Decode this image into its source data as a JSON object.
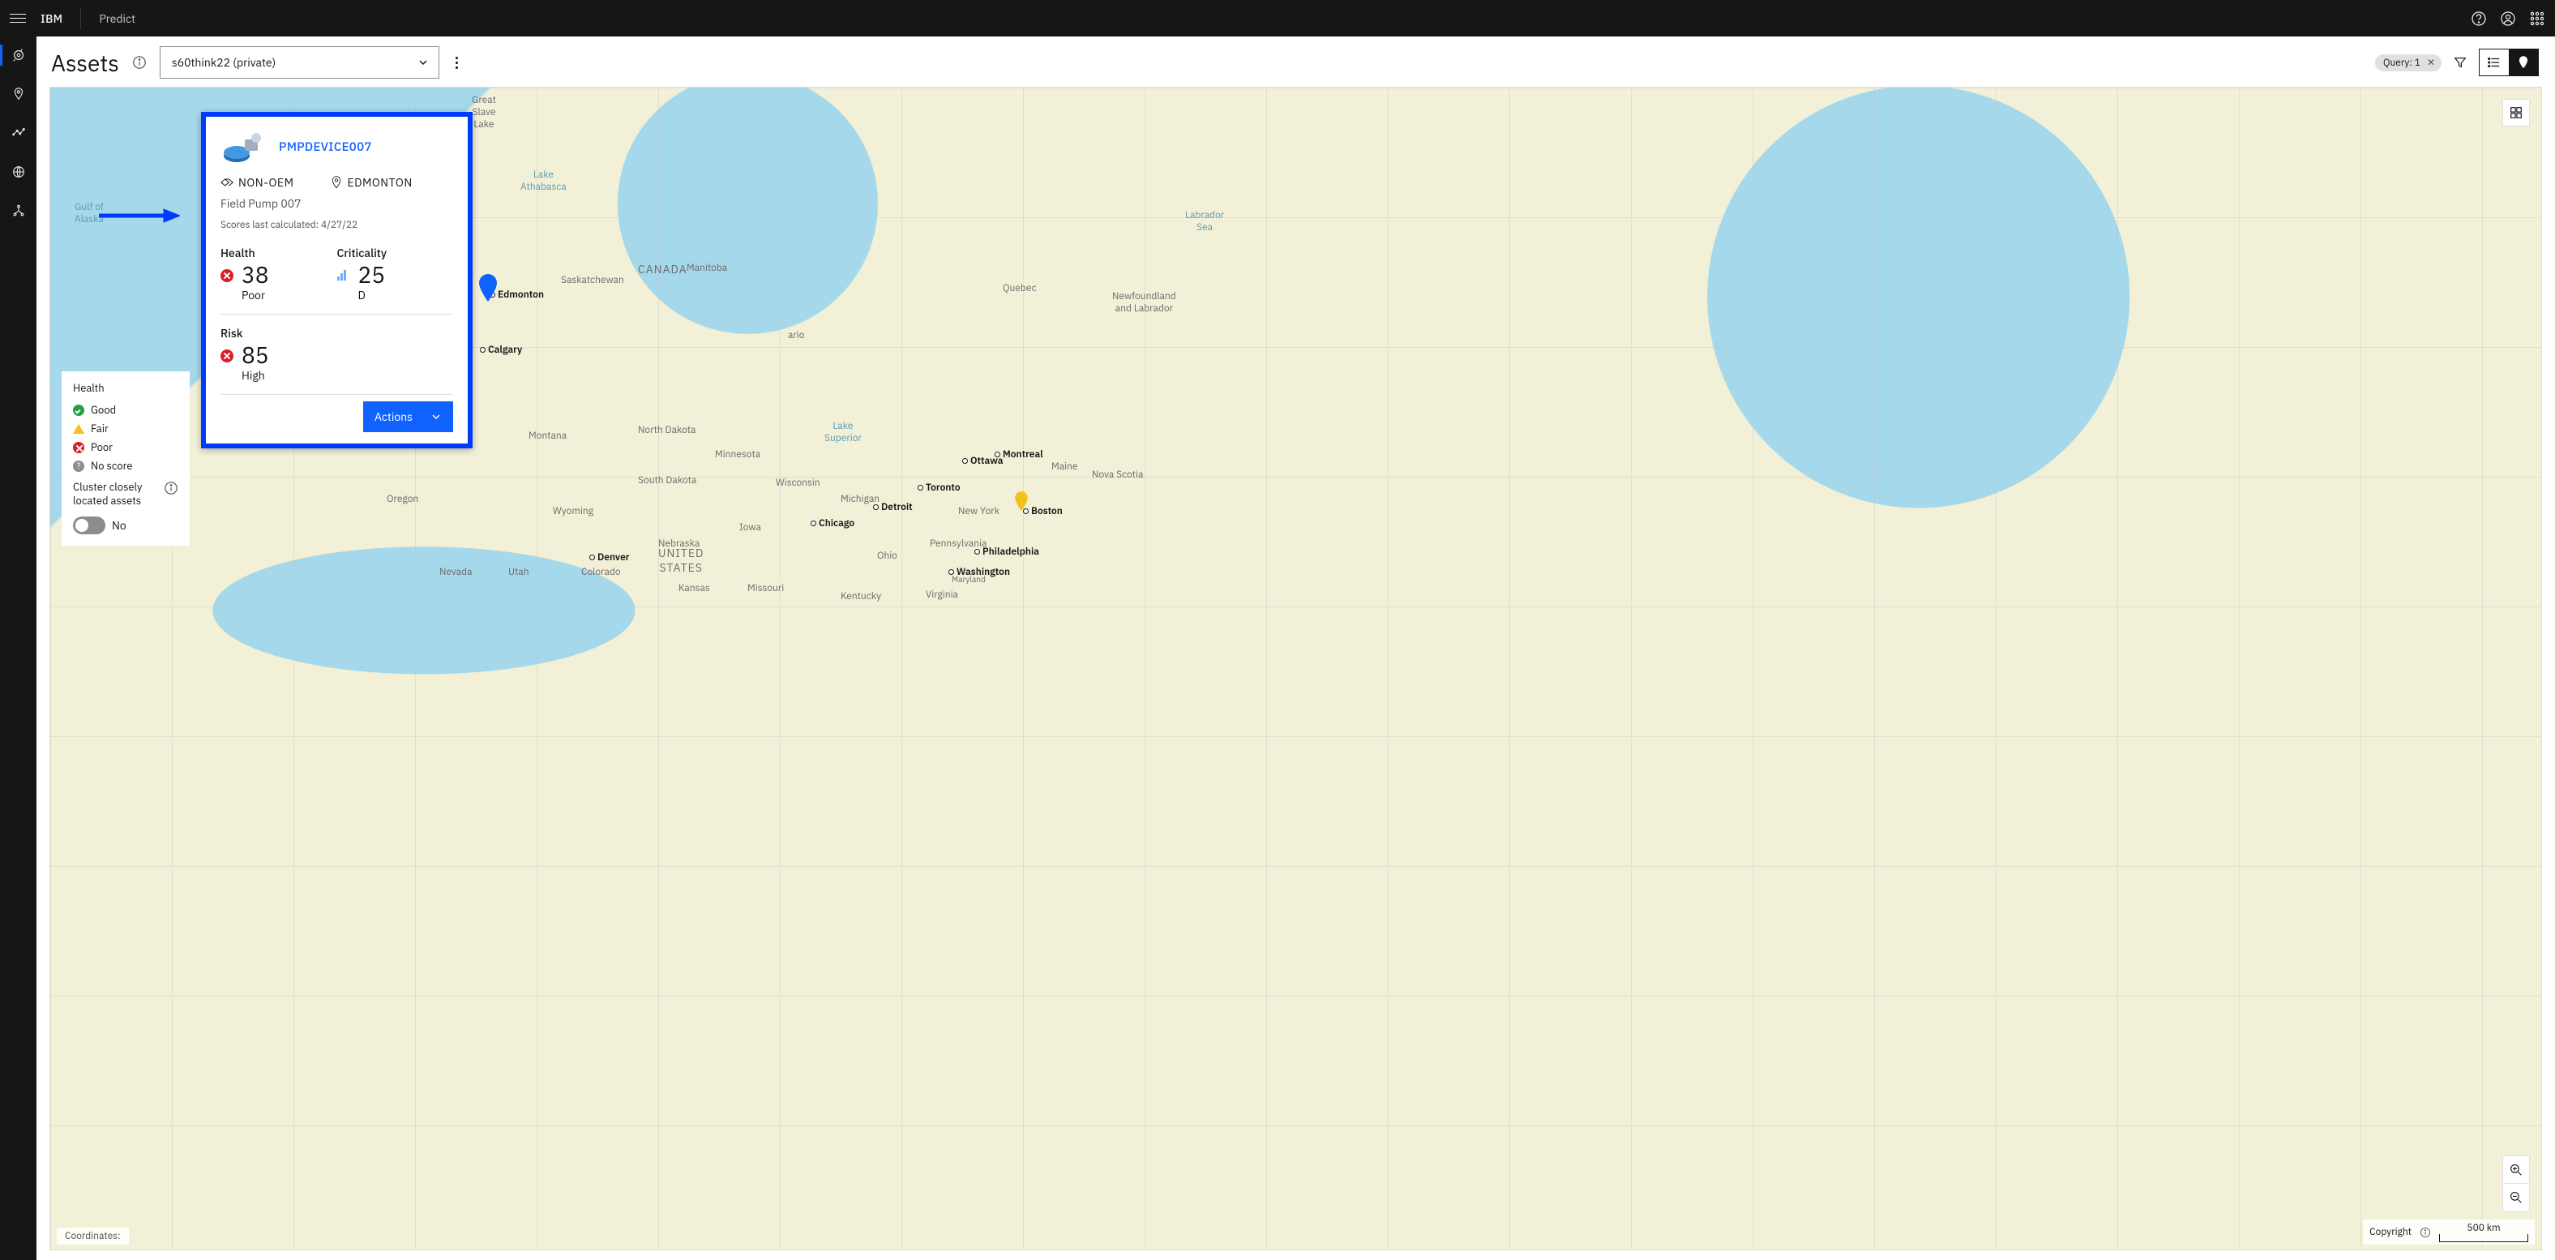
{
  "topbar": {
    "brand": "IBM",
    "app": "Predict"
  },
  "header": {
    "title": "Assets",
    "workspace": "s60think22 (private)",
    "query_tag": "Query: 1"
  },
  "popup": {
    "asset_id": "PMPDEVICE007",
    "type_label": "NON-OEM",
    "location": "EDMONTON",
    "description": "Field Pump 007",
    "calc_label": "Scores last calculated: 4/27/22",
    "health": {
      "label": "Health",
      "value": "38",
      "status": "Poor"
    },
    "criticality": {
      "label": "Criticality",
      "value": "25",
      "status": "D"
    },
    "risk": {
      "label": "Risk",
      "value": "85",
      "status": "High"
    },
    "actions_label": "Actions"
  },
  "legend": {
    "title": "Health",
    "good": "Good",
    "fair": "Fair",
    "poor": "Poor",
    "noscore": "No score",
    "cluster_text": "Cluster closely located assets",
    "toggle_label": "No"
  },
  "map": {
    "coords_label": "Coordinates:",
    "copyright": "Copyright",
    "scale": "500 km",
    "region_labels": {
      "slave_lake": "Great\nSlave\nLake",
      "gulf_alaska": "Gulf of\nAlaska",
      "athabasca": "Lake\nAthabasca",
      "sask": "Saskatchewan",
      "labrador": "Labrador\nSea",
      "nl": "Newfoundland\nand Labrador",
      "ns": "Nova Scotia",
      "superior": "Lake\nSuperior",
      "canada": "CANADA",
      "manitoba": "Manitoba",
      "quebec": "Quebec",
      "ario": "ario",
      "ndakota": "North Dakota",
      "montana": "Montana",
      "wyoming": "Wyoming",
      "colorado": "Colorado",
      "nevada": "Nevada",
      "utah": "Utah",
      "nebraska": "Nebraska",
      "iowa": "Iowa",
      "minnesota": "Minnesota",
      "wisconsin": "Wisconsin",
      "missouri": "Missouri",
      "kansas": "Kansas",
      "kentucky": "Kentucky",
      "michigan": "Michigan",
      "ohio": "Ohio",
      "pennsylvania": "Pennsylvania",
      "newyork": "New York",
      "virginia": "Virginia",
      "sdakota": "South Dakota",
      "oregon": "Oregon",
      "maine": "Maine",
      "us": "UNITED\nSTATES",
      "maryland": "Maryland"
    },
    "cities": {
      "edmonton": "Edmonton",
      "calgary": "Calgary",
      "denver": "Denver",
      "chicago": "Chicago",
      "detroit": "Detroit",
      "toronto": "Toronto",
      "ottawa": "Ottawa",
      "montreal": "Montreal",
      "boston": "Boston",
      "philadelphia": "Philadelphia",
      "washington": "Washington"
    }
  }
}
